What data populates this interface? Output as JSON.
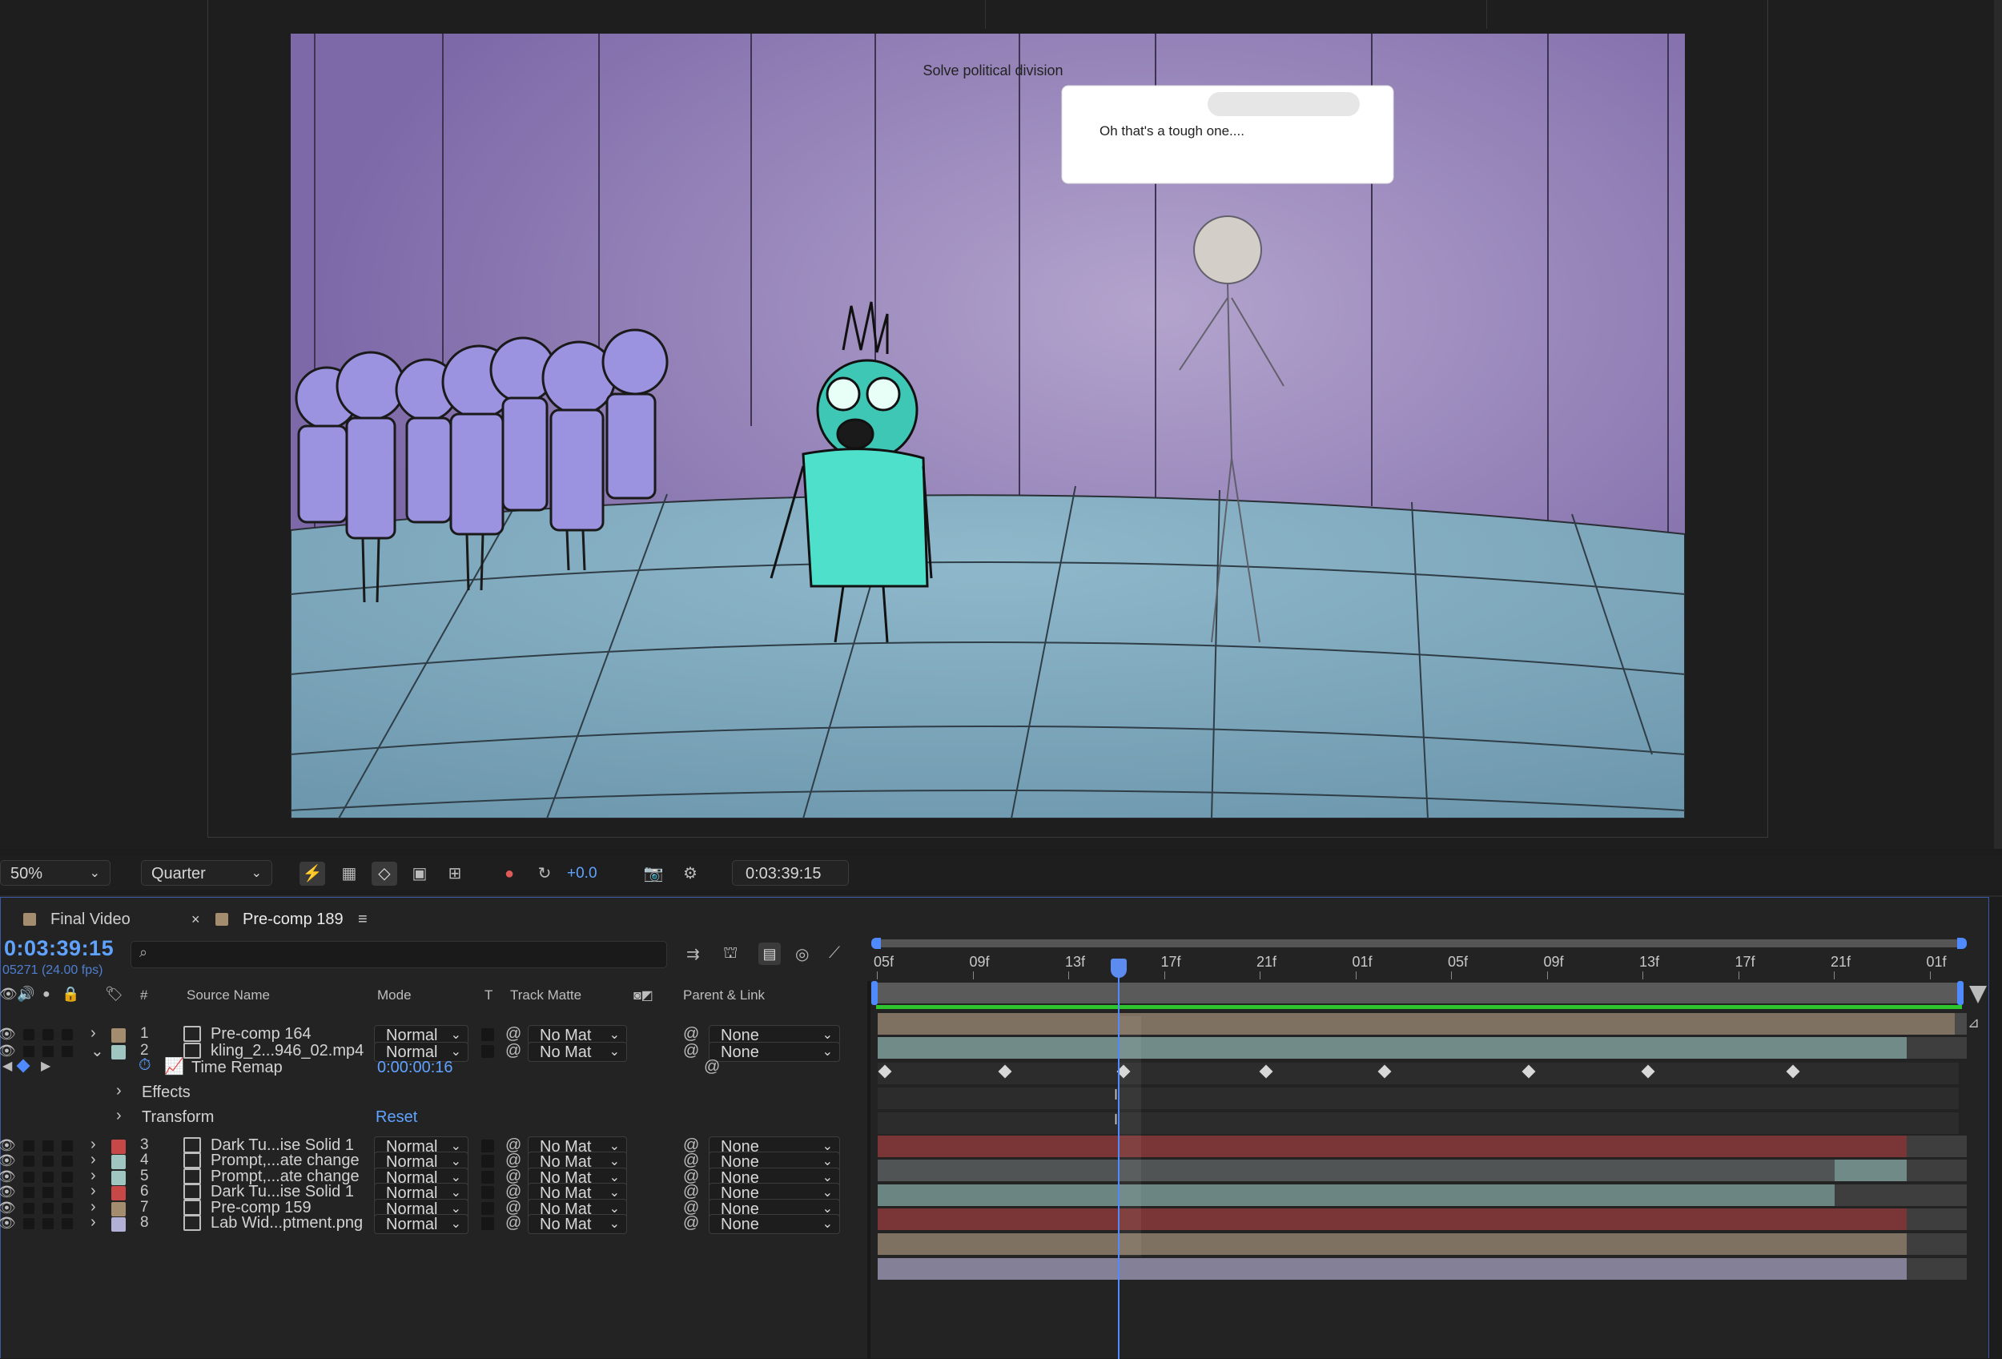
{
  "viewer": {
    "chat_chip": "Solve political division",
    "chat_reply": "Oh that's a tough one....",
    "zoom": "50%",
    "resolution": "Quarter",
    "exposure": "+0.0",
    "current_time": "0:03:39:15"
  },
  "tabs": [
    {
      "label": "Final Video",
      "color": "#a48c6e"
    },
    {
      "label": "Pre-comp 189",
      "color": "#a48c6e",
      "active": true
    }
  ],
  "timeline": {
    "timecode": "0:03:39:15",
    "fps": "05271 (24.00 fps)",
    "search_placeholder": "",
    "headers": {
      "num": "#",
      "source_name": "Source Name",
      "mode": "Mode",
      "t": "T",
      "track_matte": "Track Matte",
      "parent": "Parent & Link"
    },
    "ruler_ticks": [
      "05f",
      "09f",
      "13f",
      "17f",
      "21f",
      "01f",
      "05f",
      "09f",
      "13f",
      "17f",
      "21f",
      "01f"
    ],
    "layers": [
      {
        "num": "1",
        "name": "Pre-comp 164",
        "color": "#a48c6e",
        "mode": "Normal",
        "matte": "No Mat",
        "parent": "None",
        "icon": "precomp-icon"
      },
      {
        "num": "2",
        "name": "kling_2...946_02.mp4",
        "color": "#9fc6c0",
        "mode": "Normal",
        "matte": "No Mat",
        "parent": "None",
        "icon": "footage-icon",
        "expanded": true
      },
      {
        "num": "3",
        "name": "Dark Tu...ise Solid 1",
        "color": "#c84848",
        "mode": "Normal",
        "matte": "No Mat",
        "parent": "None",
        "icon": "solid-icon"
      },
      {
        "num": "4",
        "name": "Prompt,...ate change",
        "color": "#9fc6c0",
        "mode": "Normal",
        "matte": "No Mat",
        "parent": "None",
        "icon": "precomp-icon"
      },
      {
        "num": "5",
        "name": "Prompt,...ate change",
        "color": "#9fc6c0",
        "mode": "Normal",
        "matte": "No Mat",
        "parent": "None",
        "icon": "precomp-icon"
      },
      {
        "num": "6",
        "name": "Dark Tu...ise Solid 1",
        "color": "#c84848",
        "mode": "Normal",
        "matte": "No Mat",
        "parent": "None",
        "icon": "solid-icon"
      },
      {
        "num": "7",
        "name": "Pre-comp 159",
        "color": "#a48c6e",
        "mode": "Normal",
        "matte": "No Mat",
        "parent": "None",
        "icon": "precomp-icon"
      },
      {
        "num": "8",
        "name": "Lab Wid...ptment.png",
        "color": "#b3b0d8",
        "mode": "Normal",
        "matte": "No Mat",
        "parent": "None",
        "icon": "image-icon"
      }
    ],
    "time_remap": {
      "label": "Time Remap",
      "value": "0:00:00:16"
    },
    "effects": "Effects",
    "transform": "Transform",
    "reset": "Reset"
  }
}
